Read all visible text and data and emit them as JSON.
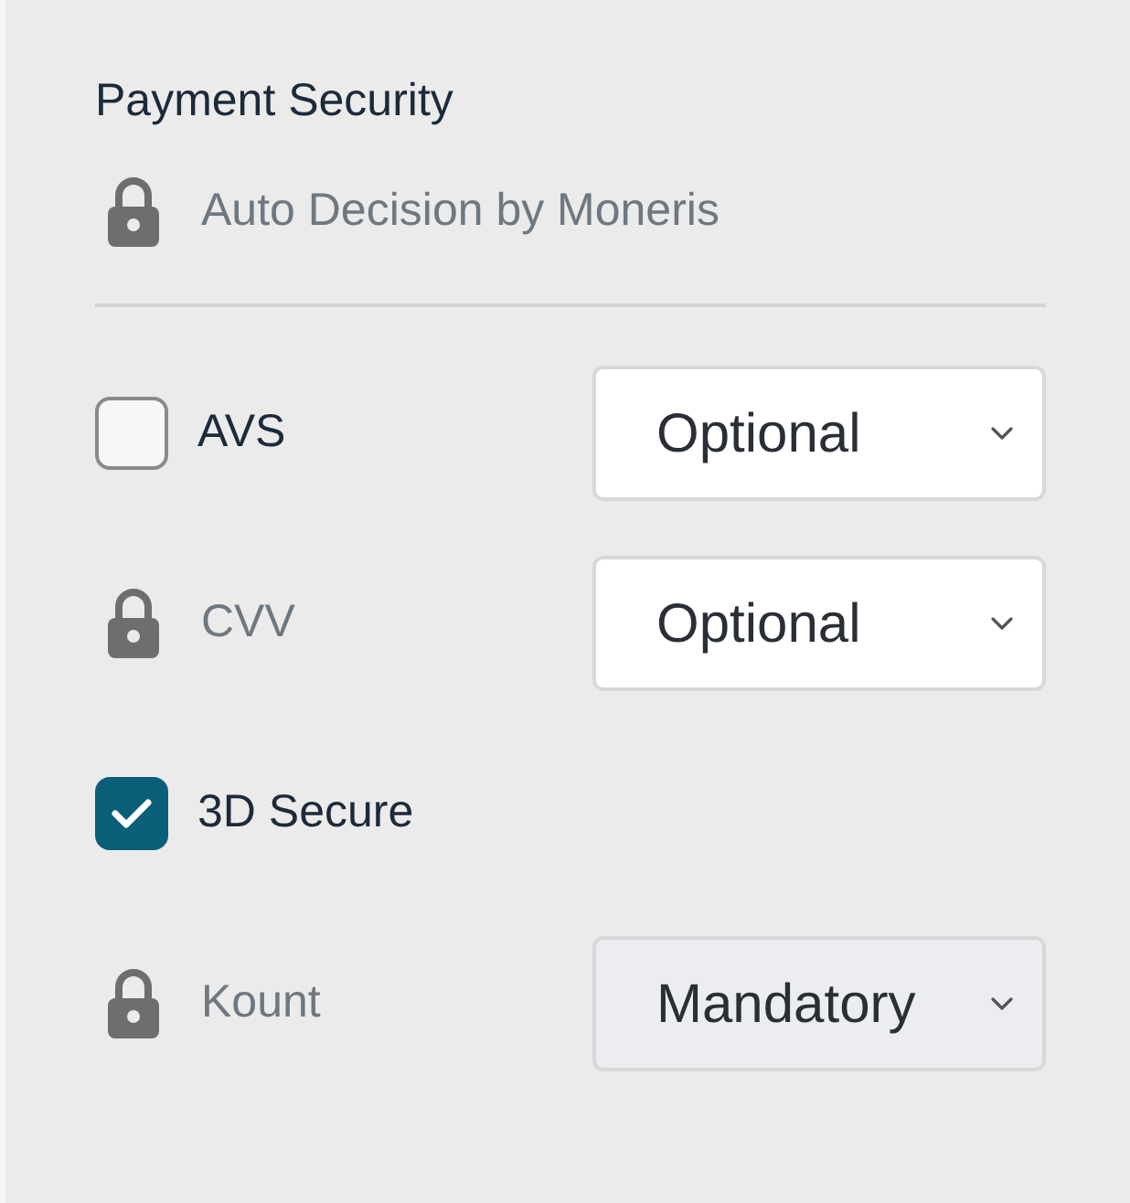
{
  "title": "Payment Security",
  "auto_decision": {
    "label": "Auto Decision by Moneris"
  },
  "options": [
    {
      "kind": "checkbox",
      "label": "AVS",
      "checked": false,
      "select": {
        "value": "Optional",
        "disabled": false
      }
    },
    {
      "kind": "locked",
      "label": "CVV",
      "select": {
        "value": "Optional",
        "disabled": false
      }
    },
    {
      "kind": "checkbox",
      "label": "3D Secure",
      "checked": true
    },
    {
      "kind": "locked",
      "label": "Kount",
      "select": {
        "value": "Mandatory",
        "disabled": true
      }
    }
  ]
}
